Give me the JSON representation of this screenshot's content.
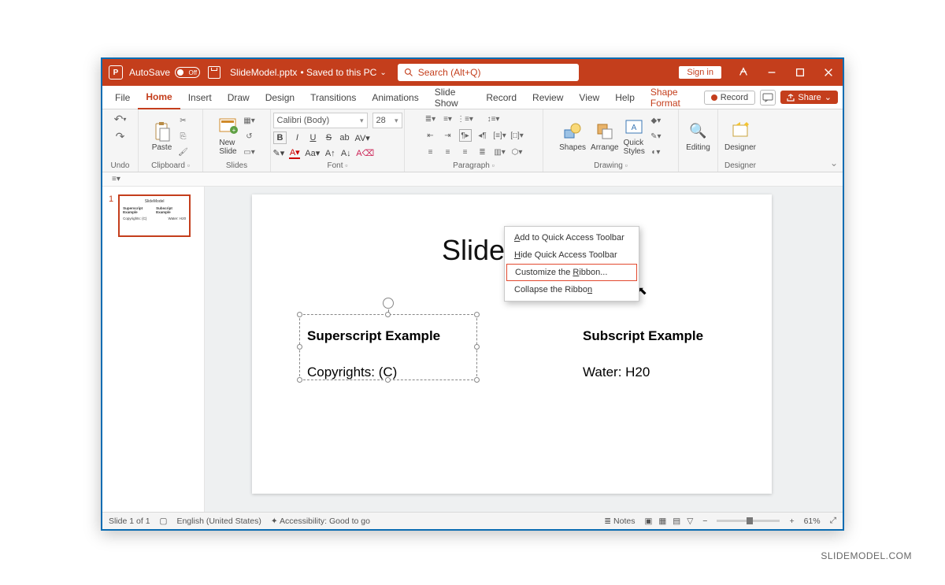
{
  "titlebar": {
    "autosave_label": "AutoSave",
    "autosave_state": "Off",
    "filename": "SlideModel.pptx",
    "saved_status": "• Saved to this PC",
    "search_placeholder": "Search (Alt+Q)",
    "signin": "Sign in"
  },
  "tabs": {
    "file": "File",
    "home": "Home",
    "insert": "Insert",
    "draw": "Draw",
    "design": "Design",
    "transitions": "Transitions",
    "animations": "Animations",
    "slideshow": "Slide Show",
    "record": "Record",
    "review": "Review",
    "view": "View",
    "help": "Help",
    "shape_format": "Shape Format",
    "record_btn": "Record",
    "share": "Share"
  },
  "ribbon": {
    "undo": "Undo",
    "clipboard": "Clipboard",
    "paste": "Paste",
    "slides": "Slides",
    "new_slide": "New\nSlide",
    "font_group": "Font",
    "font_name": "Calibri (Body)",
    "font_size": "28",
    "paragraph": "Paragraph",
    "drawing": "Drawing",
    "shapes": "Shapes",
    "arrange": "Arrange",
    "quick_styles": "Quick\nStyles",
    "editing": "Editing",
    "designer": "Designer"
  },
  "context_menu": {
    "add_qat": "Add to Quick Access Toolbar",
    "hide_qat": "Hide Quick Access Toolbar",
    "customize": "Customize the Ribbon...",
    "collapse": "Collapse the Ribbon"
  },
  "slide": {
    "number": "1",
    "title": "SlideModel",
    "left_heading": "Superscript Example",
    "left_body": "Copyrights: (C)",
    "right_heading": "Subscript Example",
    "right_body": "Water: H20"
  },
  "status": {
    "slide_pos": "Slide 1 of 1",
    "language": "English (United States)",
    "accessibility": "Accessibility: Good to go",
    "notes": "Notes",
    "zoom": "61%"
  },
  "watermark": "SLIDEMODEL.COM"
}
